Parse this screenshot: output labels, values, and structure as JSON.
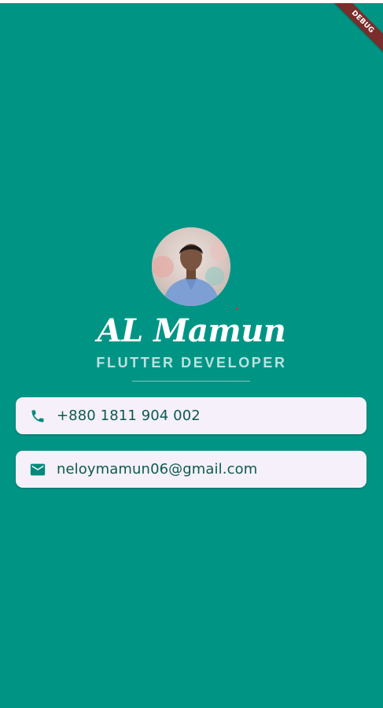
{
  "debug_banner": "DEBUG",
  "profile": {
    "name": "AL Mamun",
    "title": "FLUTTER DEVELOPER"
  },
  "contacts": {
    "phone": {
      "icon": "phone-icon",
      "value": "+880 1811 904 002"
    },
    "email": {
      "icon": "email-icon",
      "value": "neloymamun06@gmail.com"
    }
  },
  "colors": {
    "background": "#009485",
    "card": "#f5f0f9",
    "card_text": "#0c5a51",
    "title": "#b9e3df",
    "debug_banner": "#7a2d2a"
  }
}
